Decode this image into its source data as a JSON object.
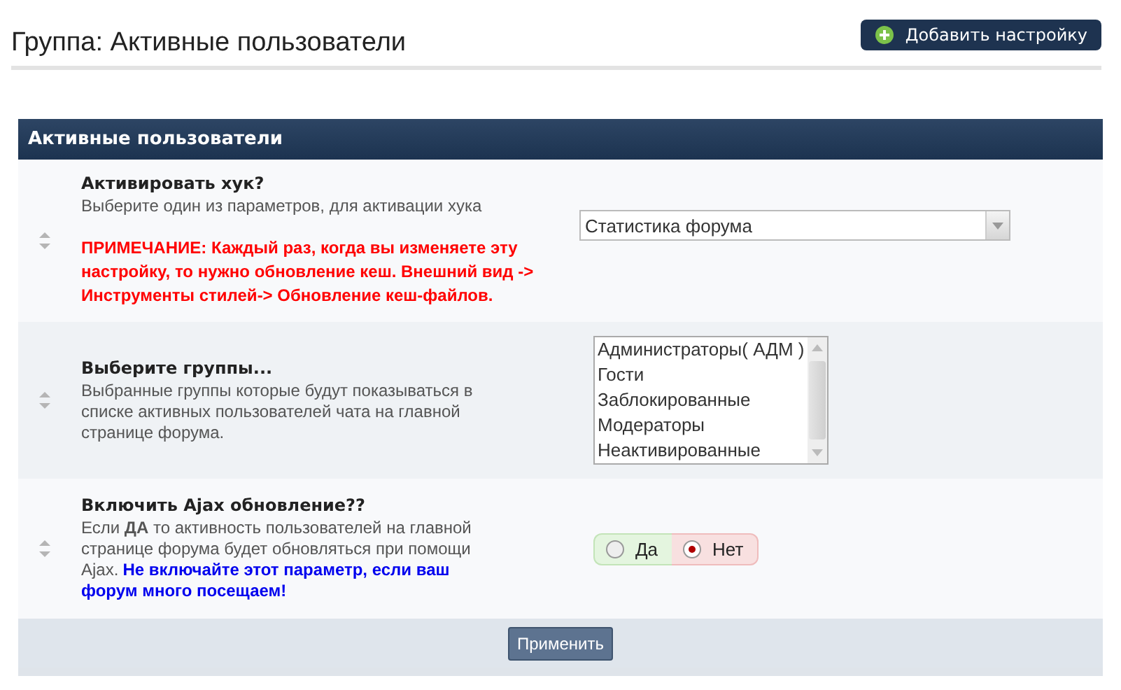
{
  "page": {
    "title": "Группа: Активные пользователи",
    "add_button": "Добавить настройку"
  },
  "panel": {
    "title": "Активные пользователи",
    "settings": [
      {
        "kind": "select",
        "label": "Активировать хук?",
        "description": "Выберите один из параметров, для активации хука",
        "note": "ПРИМЕЧАНИЕ: Каждый раз, когда вы изменяете эту настройку, то нужно обновление кеш. Внешний вид -> Инструменты стилей-> Обновление кеш-файлов.",
        "value": "Статистика форума"
      },
      {
        "kind": "listbox",
        "label": "Выберите группы...",
        "description": "Выбранные группы которые будут показываться в списке активных пользователей чата на главной странице форума.",
        "options": [
          {
            "label": "Администраторы( АДМ )",
            "selected": false
          },
          {
            "label": "Гости",
            "selected": false
          },
          {
            "label": "Заблокированные",
            "selected": false
          },
          {
            "label": "Модераторы",
            "selected": false
          },
          {
            "label": "Неактивированные",
            "selected": false
          }
        ]
      },
      {
        "kind": "yesno",
        "label": "Включить Ajax обновление??",
        "description": "Если **ДА** то активность пользователей на главной странице форума будет обновляться при помощи Ajax.",
        "warning": "Не включайте этот параметр, если ваш форум много посещаем!",
        "yes": {
          "label": "Да",
          "selected": false
        },
        "no": {
          "label": "Нет",
          "selected": true
        }
      }
    ],
    "apply_button": "Применить"
  }
}
